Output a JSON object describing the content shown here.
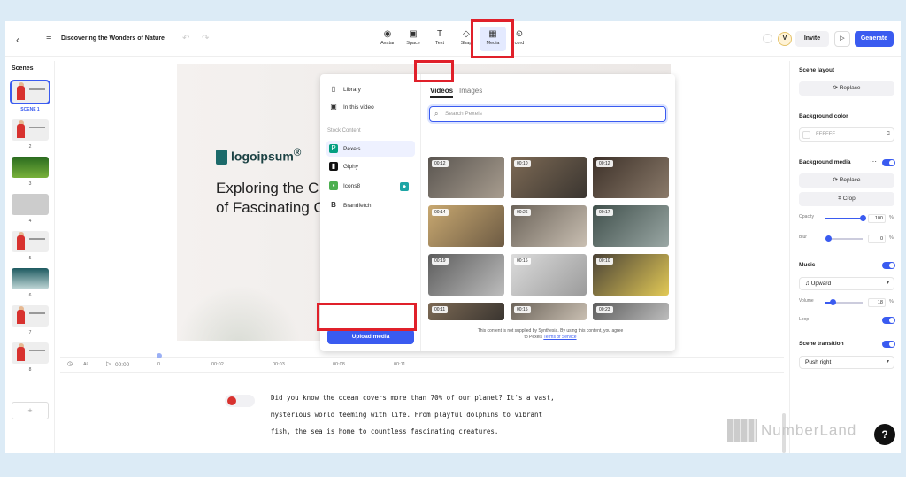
{
  "header": {
    "project_title": "Discovering the Wonders of Nature",
    "tools": [
      {
        "label": "Avatar",
        "icon": "avatar-icon"
      },
      {
        "label": "Space",
        "icon": "space-icon"
      },
      {
        "label": "Text",
        "icon": "text-icon"
      },
      {
        "label": "Shap",
        "icon": "shapes-icon"
      },
      {
        "label": "Media",
        "icon": "media-icon"
      },
      {
        "label": "cord",
        "icon": "record-icon"
      }
    ],
    "avatar_initial": "V",
    "invite_label": "Invite",
    "generate_label": "Generate"
  },
  "scenes": {
    "title": "Scenes",
    "selected_label": "SCENE 1",
    "numbers": [
      "2",
      "3",
      "4",
      "5",
      "6",
      "7",
      "8"
    ],
    "add_label": "+"
  },
  "slide": {
    "logo_text": "logoipsum",
    "logo_mark": "®",
    "heading_line1": "Exploring the C",
    "heading_line2": "of Fascinating C"
  },
  "media_panel": {
    "left_items": {
      "library": "Library",
      "in_this_video": "In this video",
      "stock_section": "Stock Content",
      "pexels": "Pexels",
      "giphy": "Giphy",
      "icons8": "Icons8",
      "brandfetch": "Brandfetch"
    },
    "upload_label": "Upload media",
    "tabs": {
      "videos": "Videos",
      "images": "Images"
    },
    "search_placeholder": "Search Pexels",
    "videos": [
      {
        "duration": "00:12"
      },
      {
        "duration": "00:10"
      },
      {
        "duration": "00:12"
      },
      {
        "duration": "00:14"
      },
      {
        "duration": "00:26"
      },
      {
        "duration": "00:17"
      },
      {
        "duration": "00:19"
      },
      {
        "duration": "00:16"
      },
      {
        "duration": "00:10"
      },
      {
        "duration": "00:11"
      },
      {
        "duration": "00:15"
      },
      {
        "duration": "00:23"
      }
    ],
    "notice_text": "This content is not supplied by Synthesia. By using this content, you agree to Pexels",
    "notice_link": "Terms of Service"
  },
  "properties": {
    "scene_layout": "Scene layout",
    "replace_label": "Replace",
    "bg_color_label": "Background color",
    "bg_color_value": "FFFFFF",
    "bg_media_label": "Background media",
    "bg_media_more": "···",
    "crop_label": "Crop",
    "opacity_label": "Opacity",
    "opacity_value": "100",
    "blur_label": "Blur",
    "blur_value": "0",
    "percent": "%",
    "music_label": "Music",
    "music_track": "Upward",
    "volume_label": "Volume",
    "volume_value": "18",
    "loop_label": "Loop",
    "transition_label": "Scene transition",
    "transition_value": "Push right"
  },
  "timeline": {
    "time": "00:00",
    "start": "0",
    "ticks": [
      "00:02",
      "00:03",
      "00:08",
      "00:11"
    ]
  },
  "script": {
    "lines": [
      "Did you know the ocean covers more than 70% of our planet? It's a vast,",
      "mysterious world teeming with life. From playful dolphins to vibrant",
      "fish, the sea is home to countless fascinating creatures."
    ]
  },
  "watermark": "NumberLand",
  "help_label": "?",
  "colors": {
    "accent": "#3a5bf0",
    "highlight": "#e0202a"
  }
}
